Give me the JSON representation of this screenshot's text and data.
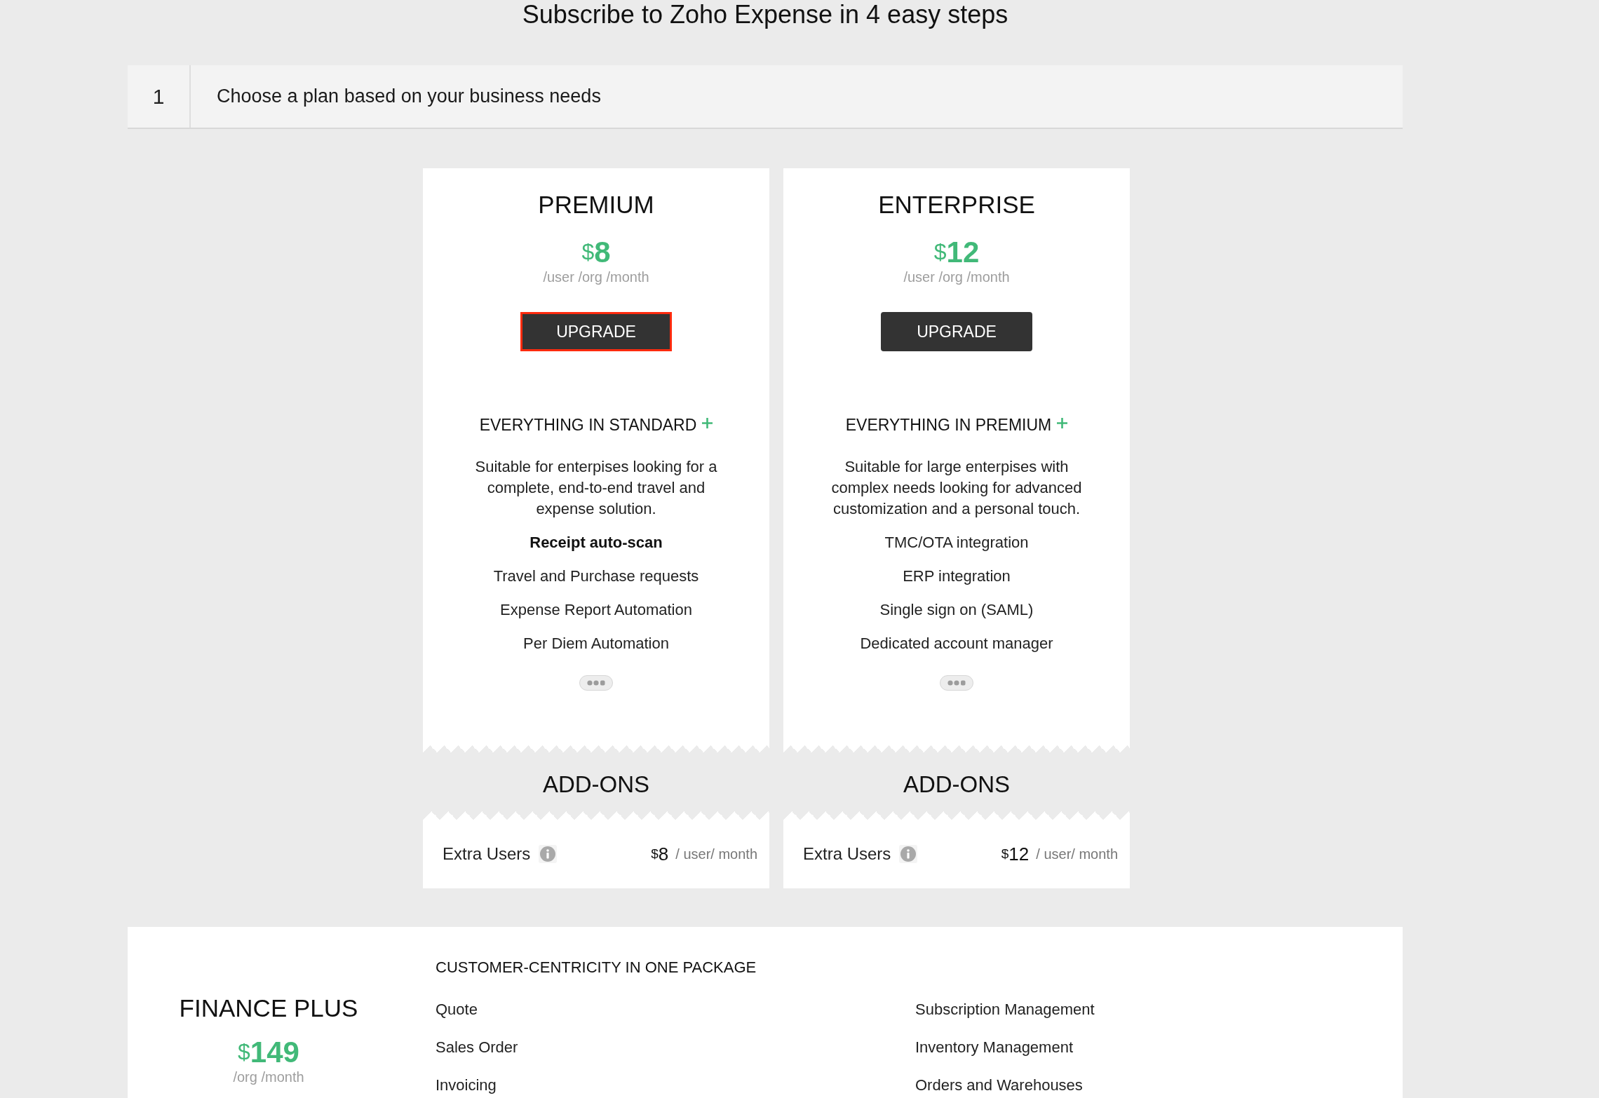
{
  "header": {
    "title": "Subscribe to Zoho Expense in 4 easy steps"
  },
  "step": {
    "number": "1",
    "label": "Choose a plan based on your business needs"
  },
  "plans": [
    {
      "name": "PREMIUM",
      "currency": "$",
      "price": "8",
      "period": "/user /org /month",
      "button": {
        "label": "UPGRADE",
        "highlighted": true
      },
      "includes": "EVERYTHING IN STANDARD",
      "description": "Suitable for enterpises looking for a complete, end-to-end travel and expense solution.",
      "features": [
        {
          "text": "Receipt auto-scan",
          "bold": true
        },
        {
          "text": "Travel and Purchase requests",
          "bold": false
        },
        {
          "text": "Expense Report Automation",
          "bold": false
        },
        {
          "text": "Per Diem Automation",
          "bold": false
        }
      ],
      "addons_title": "ADD-ONS",
      "addons": [
        {
          "name": "Extra Users",
          "currency": "$",
          "price": "8",
          "unit": "/ user/ month"
        }
      ]
    },
    {
      "name": "ENTERPRISE",
      "currency": "$",
      "price": "12",
      "period": "/user /org /month",
      "button": {
        "label": "UPGRADE",
        "highlighted": false
      },
      "includes": "EVERYTHING IN PREMIUM",
      "description": "Suitable for large enterpises with complex needs looking for advanced customization and a personal touch.",
      "features": [
        {
          "text": "TMC/OTA integration",
          "bold": false
        },
        {
          "text": "ERP integration",
          "bold": false
        },
        {
          "text": "Single sign on (SAML)",
          "bold": false
        },
        {
          "text": "Dedicated account manager",
          "bold": false
        }
      ],
      "addons_title": "ADD-ONS",
      "addons": [
        {
          "name": "Extra Users",
          "currency": "$",
          "price": "12",
          "unit": "/ user/ month"
        }
      ]
    }
  ],
  "finance_plus": {
    "name": "FINANCE PLUS",
    "currency": "$",
    "price": "149",
    "period": "/org /month",
    "heading": "CUSTOMER-CENTRICITY IN ONE PACKAGE",
    "columns": [
      [
        "Quote",
        "Sales Order",
        "Invoicing"
      ],
      [
        "Subscription Management",
        "Inventory Management",
        "Orders and Warehouses"
      ]
    ]
  }
}
